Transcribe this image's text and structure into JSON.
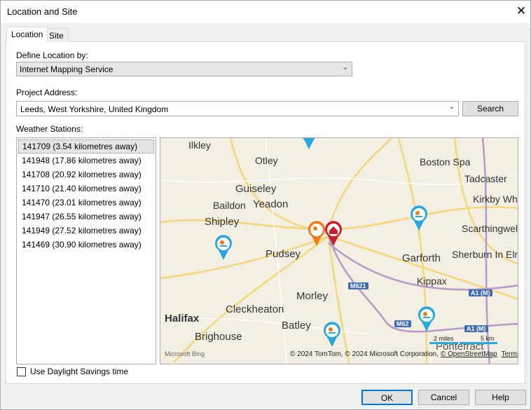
{
  "window": {
    "title": "Location and Site",
    "close_icon": "close-icon"
  },
  "tabs": [
    {
      "label": "Location"
    },
    {
      "label": "Site"
    }
  ],
  "define_location": {
    "label": "Define Location by:",
    "value": "Internet Mapping Service"
  },
  "project_address": {
    "label": "Project Address:",
    "value": "Leeds, West Yorkshire, United Kingdom",
    "search_label": "Search"
  },
  "weather_stations": {
    "label": "Weather Stations:",
    "items": [
      "141709 (3.54 kilometres away)",
      "141948 (17.86 kilometres away)",
      "141708 (20.92 kilometres away)",
      "141710 (21.40 kilometres away)",
      "141470 (23.01 kilometres away)",
      "141947 (26.55 kilometres away)",
      "141949 (27.52 kilometres away)",
      "141469 (30.90 kilometres away)"
    ],
    "selected_index": 0
  },
  "map": {
    "places": [
      "Ilkley",
      "Otley",
      "Boston Spa",
      "Tadcaster",
      "Guiseley",
      "Yeadon",
      "Baildon",
      "Kirkby Wha",
      "Shipley",
      "Scarthingwell",
      "Pudsey",
      "Sherburn In Elm",
      "Garforth",
      "Kippax",
      "Morley",
      "Cleckheaton",
      "Halifax",
      "Batley",
      "Brighouse",
      "Pontefract"
    ],
    "shields": [
      "M621",
      "M62",
      "A1 (M)",
      "A1 (M)"
    ],
    "logo": "Microsoft Bing",
    "attribution": "© 2024 TomTom, © 2024 Microsoft Corporation,",
    "osm_link": "© OpenStreetMap",
    "terms_link": "Terms",
    "scale_miles": "2 miles",
    "scale_km": "5 km",
    "colors": {
      "station": "#29a8e0",
      "project": "#c8202a",
      "selected_station": "#f07a1a"
    }
  },
  "daylight": {
    "label": "Use Daylight Savings time",
    "checked": false
  },
  "buttons": {
    "ok": "OK",
    "cancel": "Cancel",
    "help": "Help"
  }
}
